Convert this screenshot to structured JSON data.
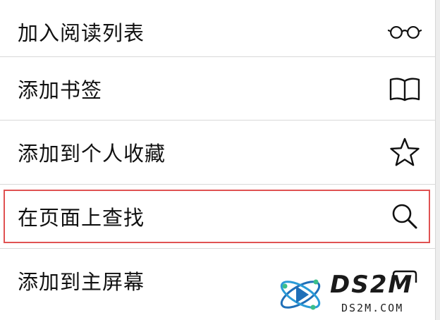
{
  "menu": {
    "items": [
      {
        "label": "加入阅读列表",
        "icon": "reading-glasses-icon"
      },
      {
        "label": "添加书签",
        "icon": "book-icon"
      },
      {
        "label": "添加到个人收藏",
        "icon": "star-icon"
      },
      {
        "label": "在页面上查找",
        "icon": "search-icon",
        "highlighted": true
      },
      {
        "label": "添加到主屏幕",
        "icon": "add-to-home-icon"
      }
    ]
  },
  "highlight_color": "#e05252",
  "watermark": {
    "title": "DS2M",
    "subtitle": "DS2M.COM"
  }
}
